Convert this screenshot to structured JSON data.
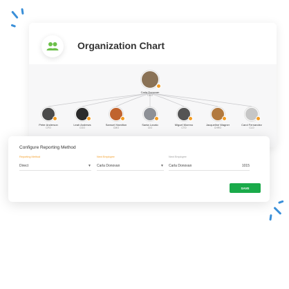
{
  "header": {
    "title": "Organization Chart",
    "logo_icon": "people-icon",
    "accent_color": "#6cc04a"
  },
  "org_chart": {
    "root": {
      "name": "Carla Donovan",
      "role": "CEO",
      "avatar_color": "#8a7256"
    },
    "reports": [
      {
        "name": "Peter Anderson",
        "role": "CFO",
        "avatar_color": "#4a4a4a"
      },
      {
        "name": "Leah Andrews",
        "role": "COO",
        "avatar_color": "#2b2b2b"
      },
      {
        "name": "Samuel Hamilton",
        "role": "CMO",
        "avatar_color": "#c0632e"
      },
      {
        "name": "Santa Lovato",
        "role": "CIO",
        "avatar_color": "#8d9096"
      },
      {
        "name": "Miguel Moreno",
        "role": "CTO",
        "avatar_color": "#545454"
      },
      {
        "name": "Jacqueline Wagner",
        "role": "CHRO",
        "avatar_color": "#b2793e"
      },
      {
        "name": "Carol Fernandez",
        "role": "CLO",
        "avatar_color": "#c6c6c6"
      }
    ],
    "badge_color": "#f39c24"
  },
  "form": {
    "title": "Configure Reporting Method",
    "fields": [
      {
        "label": "Reporting Method",
        "value": "Direct",
        "has_dropdown": true
      },
      {
        "label": "Next Employee",
        "value": "Carla Donovan",
        "has_dropdown": true
      },
      {
        "label": "Next Employee",
        "value": "Carla Donovan",
        "suffix": "1015",
        "has_dropdown": false
      }
    ],
    "save_label": "SAVE",
    "save_color": "#1aaa4a"
  }
}
